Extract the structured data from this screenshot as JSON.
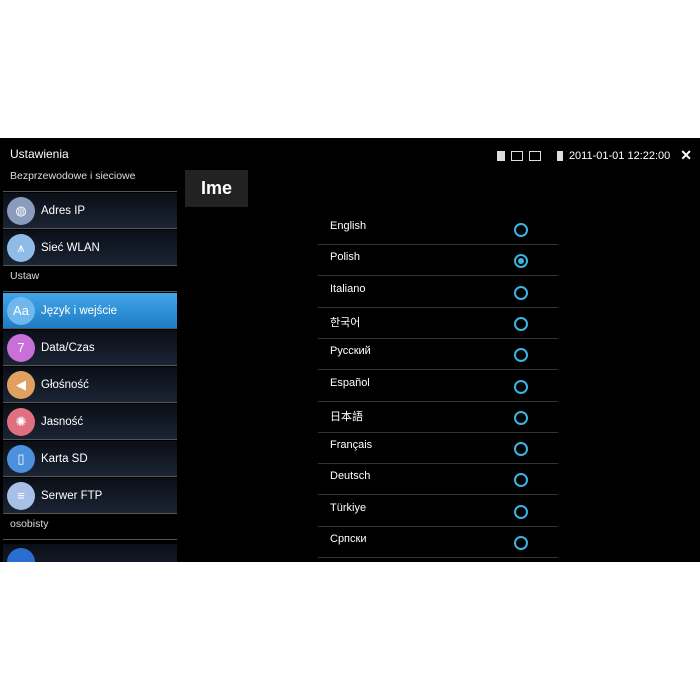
{
  "header": {
    "title": "Ustawienia",
    "datetime": "2011-01-01 12:22:00",
    "icons": [
      "sd-card-icon",
      "monitor-off-icon",
      "monitor-off-icon",
      "battery-icon",
      "close-icon"
    ]
  },
  "sidebar": {
    "sections": [
      {
        "label": "Bezprzewodowe i sieciowe",
        "items": [
          {
            "label": "Adres IP",
            "icon": "globe-icon",
            "color": "#8a9bbd"
          },
          {
            "label": "Sieć WLAN",
            "icon": "antenna-icon",
            "color": "#8fbce6"
          }
        ]
      },
      {
        "label": "Ustaw",
        "items": [
          {
            "label": "Język i wejście",
            "icon": "language-icon",
            "color": "#6fb8ee",
            "active": true
          },
          {
            "label": "Data/Czas",
            "icon": "calendar-icon",
            "color": "#c86fd8"
          },
          {
            "label": "Głośność",
            "icon": "speaker-icon",
            "color": "#e0a060"
          },
          {
            "label": "Jasność",
            "icon": "bulb-icon",
            "color": "#e07080"
          },
          {
            "label": "Karta SD",
            "icon": "sd-card-icon",
            "color": "#4d90dd"
          },
          {
            "label": "Serwer FTP",
            "icon": "server-icon",
            "color": "#a8c0e8"
          }
        ]
      },
      {
        "label": "osobisty",
        "items": []
      }
    ]
  },
  "main": {
    "ime_label": "Ime",
    "accent": "#3ab4e0",
    "languages": [
      {
        "label": "English",
        "selected": false
      },
      {
        "label": "Polish",
        "selected": true
      },
      {
        "label": "Italiano",
        "selected": false
      },
      {
        "label": "한국어",
        "selected": false
      },
      {
        "label": "Русский",
        "selected": false
      },
      {
        "label": "Español",
        "selected": false
      },
      {
        "label": "日本語",
        "selected": false
      },
      {
        "label": "Français",
        "selected": false
      },
      {
        "label": "Deutsch",
        "selected": false
      },
      {
        "label": "Türkiye",
        "selected": false
      },
      {
        "label": "Српски",
        "selected": false
      }
    ]
  }
}
